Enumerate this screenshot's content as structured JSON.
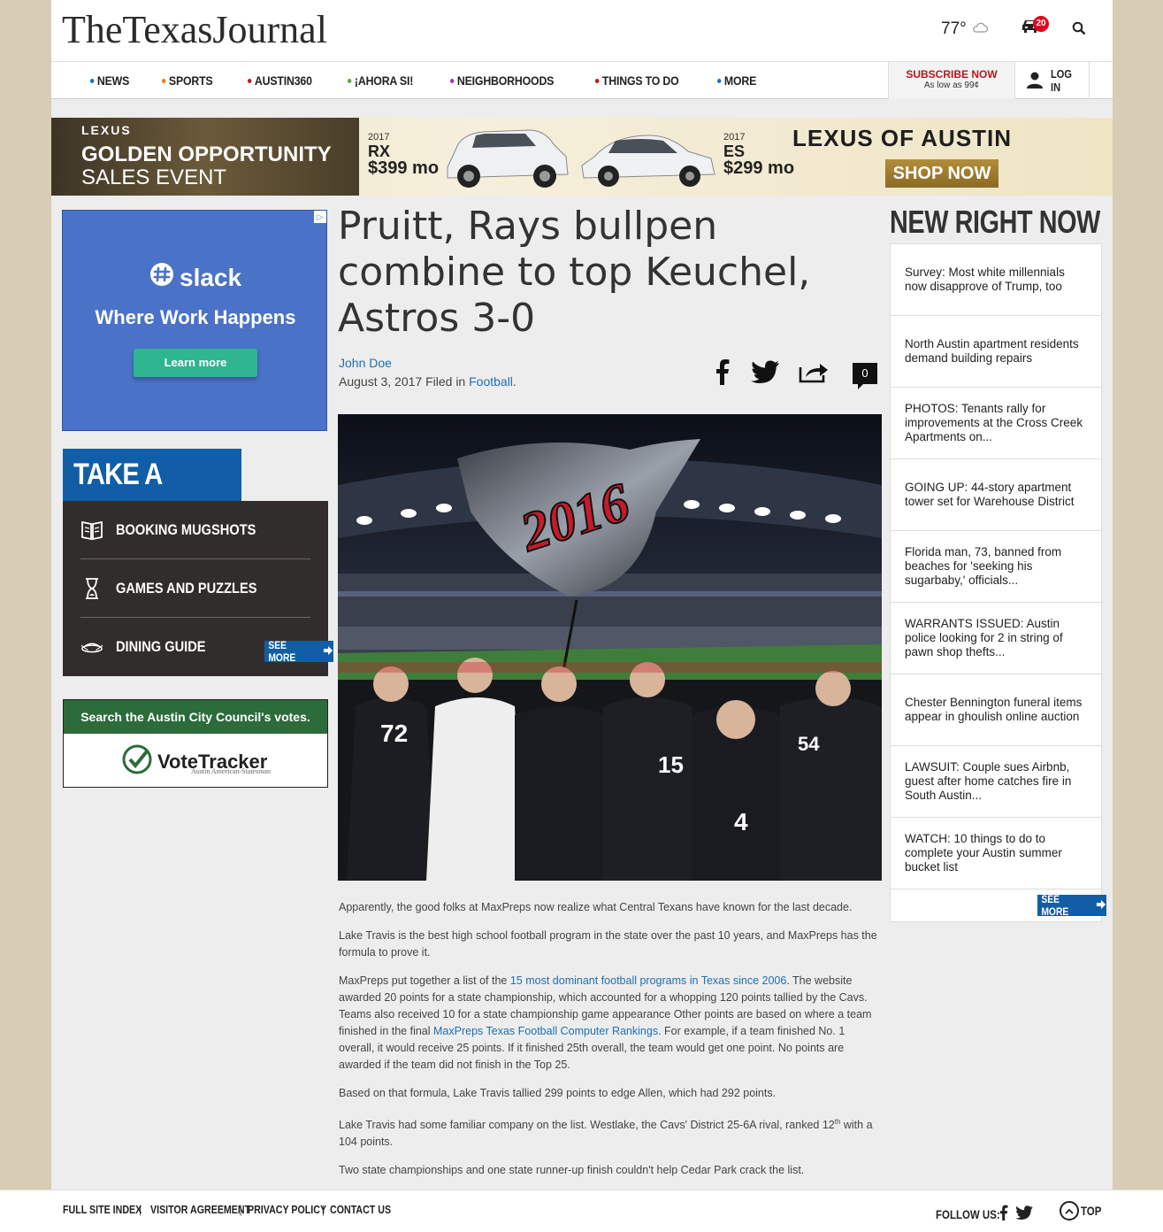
{
  "header": {
    "logo": "TheTexasJournal",
    "weather_temp": "77°",
    "traffic_count": "20"
  },
  "nav": {
    "items": [
      {
        "label": "NEWS",
        "color": "#1f6fb5"
      },
      {
        "label": "SPORTS",
        "color": "#f07a1a"
      },
      {
        "label": "AUSTIN360",
        "color": "#c2161b"
      },
      {
        "label": "¡AHORA SI!",
        "color": "#5fa83a"
      },
      {
        "label": "NEIGHBORHOODS",
        "color": "#a83aa0"
      },
      {
        "label": "THINGS TO DO",
        "color": "#c2161b"
      },
      {
        "label": "MORE",
        "color": "#1f6fb5"
      }
    ],
    "subscribe_title": "SUBSCRIBE NOW",
    "subscribe_sub": "As low as 99¢",
    "login": "LOG IN"
  },
  "top_ad": {
    "brand": "LEXUS",
    "headline1": "GOLDEN OPPORTUNITY",
    "headline2": "SALES EVENT",
    "model1_year": "2017",
    "model1_name": "RX",
    "model1_price": "$399 mo",
    "model2_year": "2017",
    "model2_name": "ES",
    "model2_price": "$299 mo",
    "dealer": "LEXUS OF AUSTIN",
    "cta": "SHOP NOW"
  },
  "slack_ad": {
    "brand": "slack",
    "tagline": "Where Work Happens",
    "cta": "Learn more"
  },
  "take_a_break": {
    "title": "TAKE A BREAK",
    "items": [
      {
        "label": "BOOKING MUGSHOTS",
        "icon": "book-icon"
      },
      {
        "label": "GAMES AND PUZZLES",
        "icon": "hourglass-icon"
      },
      {
        "label": "DINING GUIDE",
        "icon": "dish-icon"
      }
    ],
    "see_more": "SEE MORE"
  },
  "vote_tracker": {
    "header": "Search the Austin City Council's votes.",
    "name": "VoteTracker",
    "sub": "Austin American-Statesman"
  },
  "article": {
    "headline": "Pruitt, Rays bullpen combine to top Keuchel, Astros 3-0",
    "author": "John Doe",
    "date": "August 3, 2017",
    "filed_in": "Filed in",
    "category": "Football",
    "period": ".",
    "comment_count": "0",
    "p1": "Apparently, the good folks at MaxPreps now realize what Central Texans have known for the last decade.",
    "p2": "Lake Travis is the best high school football program in the state over the past 10 years, and MaxPreps has the formula to prove it.",
    "p3a": "MaxPreps put together a list of the ",
    "p3_link1": "15 most dominant football programs in Texas since 2006",
    "p3b": ". The website awarded 20 points for a state championship, which accounted for a whopping 120 points tallied by the Cavs. Teams also received 10 for a state championship game appearance Other points are based on where a team finished in the final ",
    "p3_link2": "MaxPreps Texas Football Computer Rankings",
    "p3c": ". For example, if a team finished No. 1 overall, it would receive 25 points. If it finished 25th overall, the team would get one point. No points are awarded if the team did not finish in the Top 25.",
    "p4": "Based on that formula, Lake Travis tallied 299 points to edge Allen, which had 292 points.",
    "p5a": "Lake Travis had some familiar company on the list. Westlake, the Cavs' District 25-6A rival, ranked 12",
    "p5_sup": "th",
    "p5b": " with a 104 points.",
    "p6": "Two state championships and one state runner-up finish couldn't help Cedar Park crack the list.",
    "photo_flag_text": "2016",
    "jersey_numbers": [
      "72",
      "15",
      "4",
      "54"
    ]
  },
  "right_now": {
    "title": "NEW RIGHT NOW",
    "items": [
      "Survey: Most white millennials now disapprove of Trump, too",
      "North Austin apartment residents demand building repairs",
      "PHOTOS: Tenants rally for improvements at the Cross Creek Apartments on...",
      "GOING UP: 44-story apartment tower set for Warehouse District",
      "Florida man, 73, banned from beaches for 'seeking his sugarbaby,' officials...",
      "WARRANTS ISSUED: Austin police looking for 2 in string of pawn shop thefts...",
      "Chester Bennington funeral items appear in ghoulish online auction",
      "LAWSUIT: Couple sues Airbnb, guest after home catches fire in South Austin...",
      "WATCH: 10 things to do to complete your Austin summer bucket list"
    ],
    "see_more": "SEE MORE"
  },
  "footer": {
    "links": [
      "FULL SITE INDEX",
      "VISITOR AGREEMENT",
      "PRIVACY POLICY",
      "CONTACT US"
    ],
    "follow": "FOLLOW US:",
    "top": "TOP"
  }
}
